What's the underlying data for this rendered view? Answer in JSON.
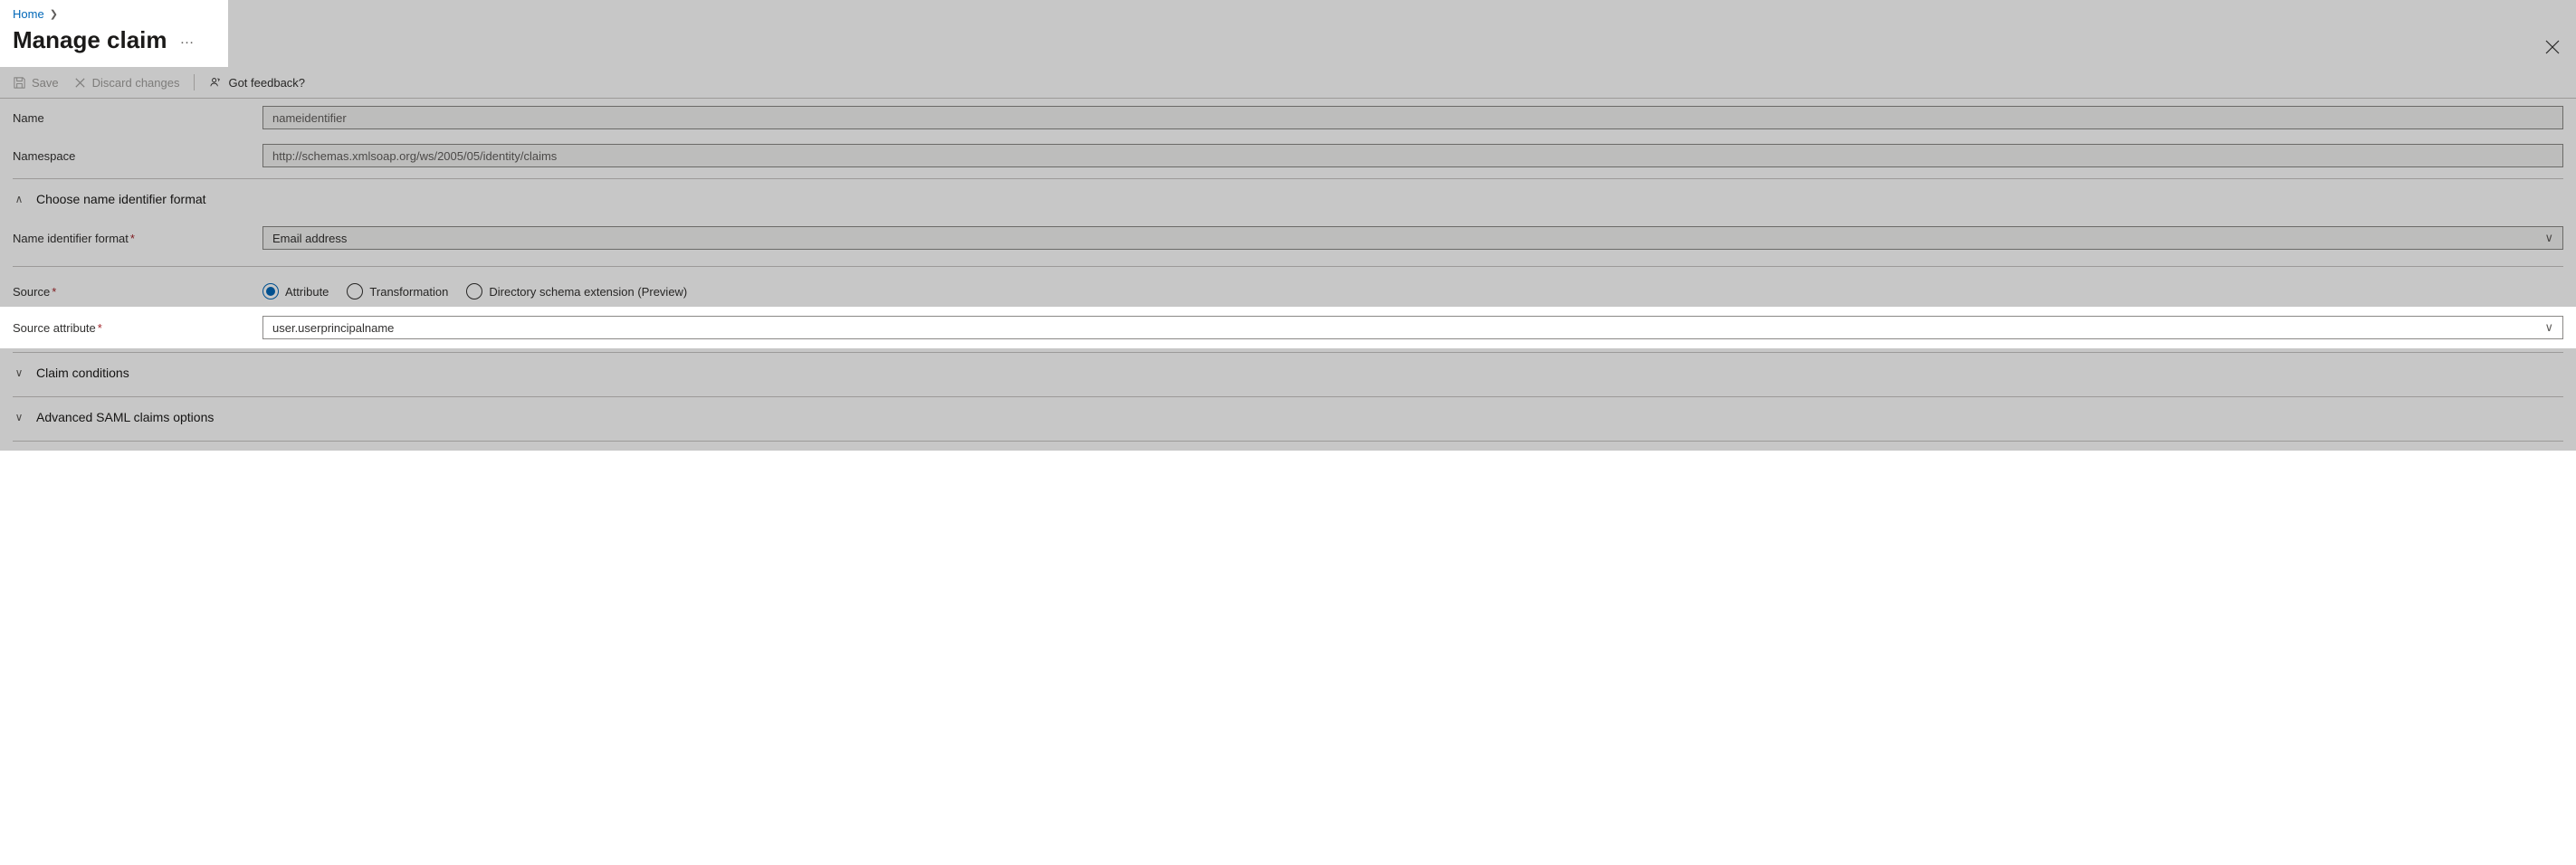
{
  "breadcrumb": {
    "home": "Home"
  },
  "page": {
    "title": "Manage claim"
  },
  "toolbar": {
    "save": "Save",
    "discard": "Discard changes",
    "feedback": "Got feedback?"
  },
  "fields": {
    "name_label": "Name",
    "name_value": "nameidentifier",
    "namespace_label": "Namespace",
    "namespace_value": "http://schemas.xmlsoap.org/ws/2005/05/identity/claims",
    "nif_section": "Choose name identifier format",
    "nif_label": "Name identifier format",
    "nif_value": "Email address",
    "source_label": "Source",
    "source_options": {
      "attribute": "Attribute",
      "transformation": "Transformation",
      "directory": "Directory schema extension (Preview)"
    },
    "source_attr_label": "Source attribute",
    "source_attr_value": "user.userprincipalname"
  },
  "sections": {
    "claim_conditions": "Claim conditions",
    "advanced": "Advanced SAML claims options"
  }
}
